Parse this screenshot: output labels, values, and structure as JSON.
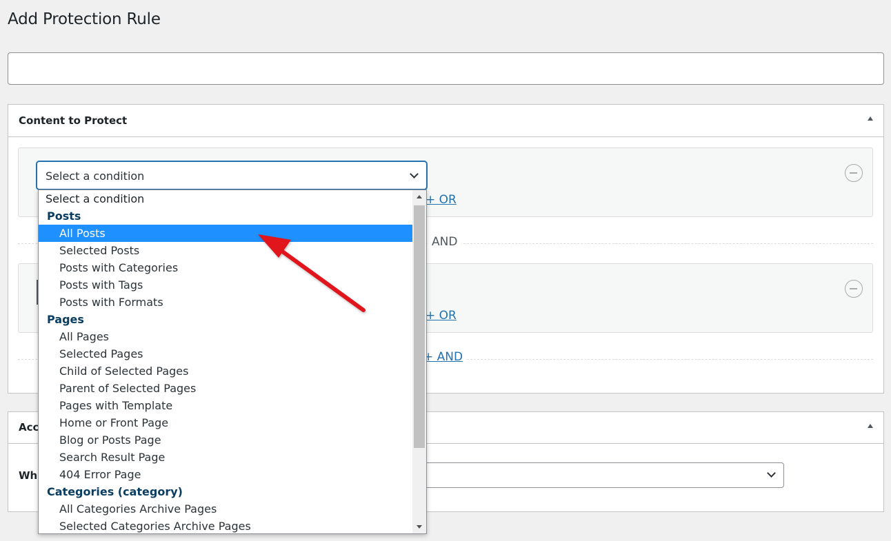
{
  "page": {
    "title": "Add Protection Rule",
    "title_input_value": ""
  },
  "content_box": {
    "title": "Content to Protect",
    "condition_select": {
      "value": "Select a condition"
    },
    "or_label": "+ OR",
    "and_text": "AND",
    "and_link": "+ AND"
  },
  "access_box": {
    "title_partial": "Acc",
    "label_partial": "Wh",
    "select_value": ""
  },
  "dropdown": {
    "placeholder": "Select a condition",
    "groups": [
      {
        "label": "Posts",
        "options": [
          "All Posts",
          "Selected Posts",
          "Posts with Categories",
          "Posts with Tags",
          "Posts with Formats"
        ]
      },
      {
        "label": "Pages",
        "options": [
          "All Pages",
          "Selected Pages",
          "Child of Selected Pages",
          "Parent of Selected Pages",
          "Pages with Template",
          "Home or Front Page",
          "Blog or Posts Page",
          "Search Result Page",
          "404 Error Page"
        ]
      },
      {
        "label": "Categories (category)",
        "options": [
          "All Categories Archive Pages",
          "Selected Categories Archive Pages"
        ]
      }
    ],
    "highlighted": "All Posts"
  },
  "colors": {
    "accent": "#2271b1",
    "highlight": "#1e90ff",
    "arrow": "#e0141b"
  }
}
